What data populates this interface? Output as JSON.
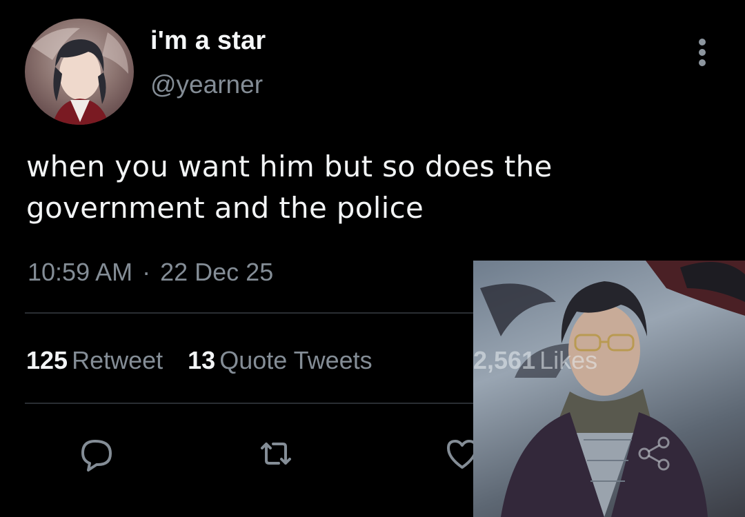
{
  "tweet": {
    "author": {
      "display_name": "i'm a star",
      "handle": "@yearner"
    },
    "text": "when you want him but so does the government and the police",
    "time": "10:59 AM",
    "separator": "·",
    "date": "22 Dec 25"
  },
  "stats": {
    "retweets": {
      "count": "125",
      "label": "Retweet"
    },
    "quotes": {
      "count": "13",
      "label": "Quote Tweets"
    },
    "likes": {
      "count": "2,561",
      "label": "Likes"
    }
  },
  "actions": [
    {
      "icon": "reply-icon"
    },
    {
      "icon": "retweet-icon"
    },
    {
      "icon": "like-icon"
    },
    {
      "icon": "share-icon"
    }
  ],
  "colors": {
    "background": "#000000",
    "primary_text": "#f2f4f5",
    "secondary_text": "#848d96",
    "divider": "#2a2e33"
  }
}
